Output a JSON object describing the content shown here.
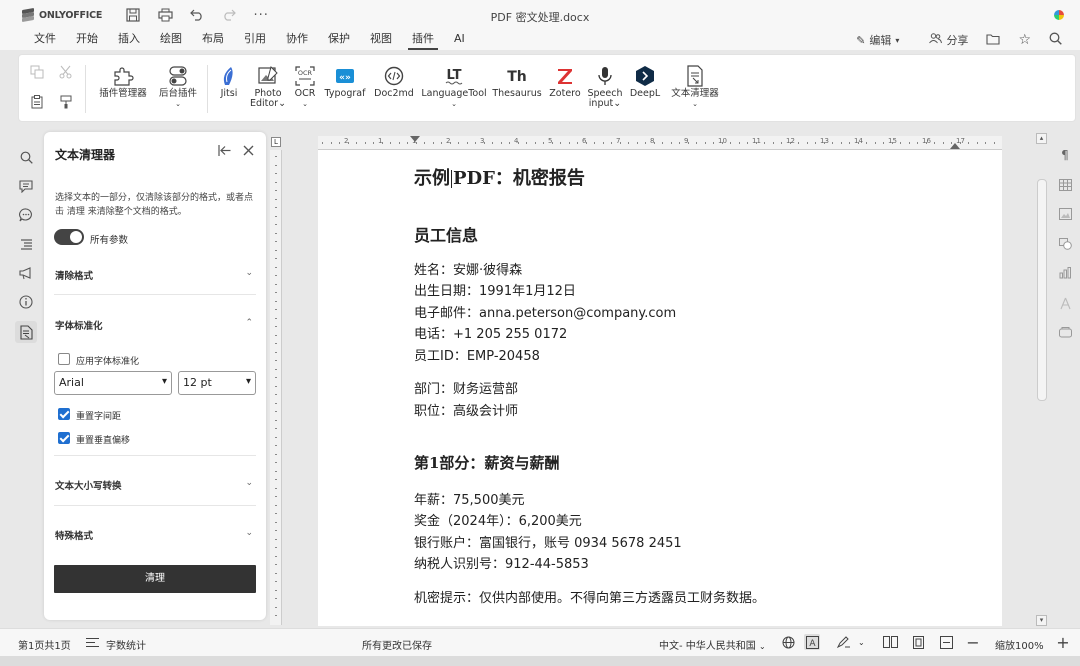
{
  "app": {
    "brand": "ONLYOFFICE",
    "document_title": "PDF 密文处理.docx"
  },
  "menu": {
    "items": [
      "文件",
      "开始",
      "插入",
      "绘图",
      "布局",
      "引用",
      "协作",
      "保护",
      "视图",
      "插件",
      "AI"
    ],
    "active": "插件",
    "edit_label": "编辑",
    "share_label": "分享"
  },
  "toolbar": {
    "plugin_manager": "插件管理器",
    "background_plugins": "后台插件",
    "plugins": [
      {
        "label": "Jitsi"
      },
      {
        "label": "Photo",
        "label2": "Editor"
      },
      {
        "label": "OCR"
      },
      {
        "label": "Typograf"
      },
      {
        "label": "Doc2md"
      },
      {
        "label": "LanguageTool"
      },
      {
        "label": "Thesaurus"
      },
      {
        "label": "Zotero"
      },
      {
        "label": "Speech",
        "label2": "input"
      },
      {
        "label": "DeepL"
      },
      {
        "label": "文本清理器"
      }
    ]
  },
  "panel": {
    "title": "文本清理器",
    "description": "选择文本的一部分，仅清除该部分的格式，或者点击 清理 来清除整个文档的格式。",
    "toggle_label": "所有参数",
    "toggle_on": true,
    "sections": {
      "clear_format": "清除格式",
      "font_normalize": "字体标准化",
      "case_convert": "文本大小写转换",
      "special_format": "特殊格式"
    },
    "apply_font_label": "应用字体标准化",
    "apply_font_checked": false,
    "font_name": "Arial",
    "font_size": "12 pt",
    "reset_spacing_label": "重置字间距",
    "reset_spacing_checked": true,
    "reset_vertical_label": "重置垂直偏移",
    "reset_vertical_checked": true,
    "clear_button": "清理"
  },
  "document": {
    "title_pre": "示例",
    "title_post": "PDF：机密报告",
    "heading_employee": "员工信息",
    "lines_a": [
      "姓名：安娜·彼得森",
      "出生日期：1991年1月12日",
      "电子邮件：anna.peterson@company.com",
      "电话：+1 205 255 0172",
      "员工ID：EMP-20458"
    ],
    "lines_b": [
      "部门：财务运营部",
      "职位：高级会计师"
    ],
    "heading_part1": "第1部分：薪资与薪酬",
    "lines_c": [
      "年薪：75,500美元",
      "奖金（2024年）：6,200美元",
      "银行账户：富国银行，账号 0934 5678 2451",
      "纳税人识别号：912-44-5853"
    ],
    "confidential_note": "机密提示：仅供内部使用。不得向第三方透露员工财务数据。"
  },
  "ruler": {
    "numbers": [
      "2",
      "1",
      "1",
      "2",
      "3",
      "4",
      "5",
      "6",
      "7",
      "8",
      "9",
      "10",
      "11",
      "12",
      "13",
      "14",
      "15",
      "16",
      "17"
    ]
  },
  "status": {
    "page_info": "第1页共1页",
    "word_count": "字数统计",
    "saved": "所有更改已保存",
    "language": "中文- 中华人民共和国",
    "zoom": "缩放100%"
  }
}
